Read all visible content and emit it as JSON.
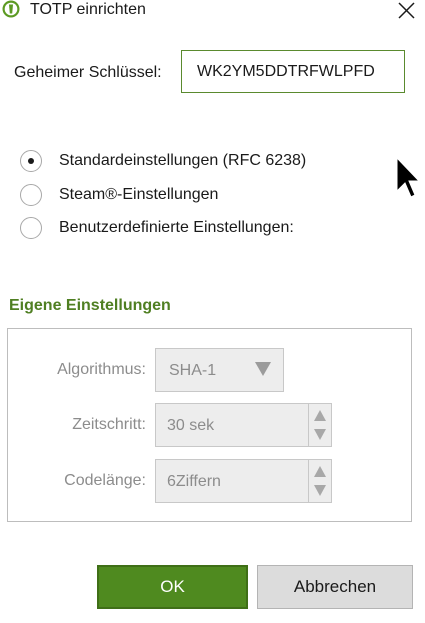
{
  "window": {
    "title": "TOTP einrichten",
    "app_icon": "keepassxc-shield-icon",
    "close_icon": "close-icon"
  },
  "secret": {
    "label": "Geheimer Schlüssel:",
    "value": "WK2YM5DDTRFWLPFD"
  },
  "options": [
    {
      "label": "Standardeinstellungen (RFC 6238)",
      "checked": true
    },
    {
      "label": "Steam®-Einstellungen",
      "checked": false
    },
    {
      "label": "Benutzerdefinierte Einstellungen:",
      "checked": false
    }
  ],
  "custom": {
    "title": "Eigene Einstellungen",
    "algorithm_label": "Algorithmus:",
    "algorithm_value": "SHA-1",
    "timestep_label": "Zeitschritt:",
    "timestep_value": "30 sek",
    "codelength_label": "Codelänge:",
    "codelength_value": "6Ziffern",
    "enabled": false
  },
  "buttons": {
    "ok": "OK",
    "cancel": "Abbrechen"
  },
  "colors": {
    "accent": "#4f8a1f",
    "section_title": "#4f7f22",
    "disabled_text": "#8c8c8c"
  }
}
